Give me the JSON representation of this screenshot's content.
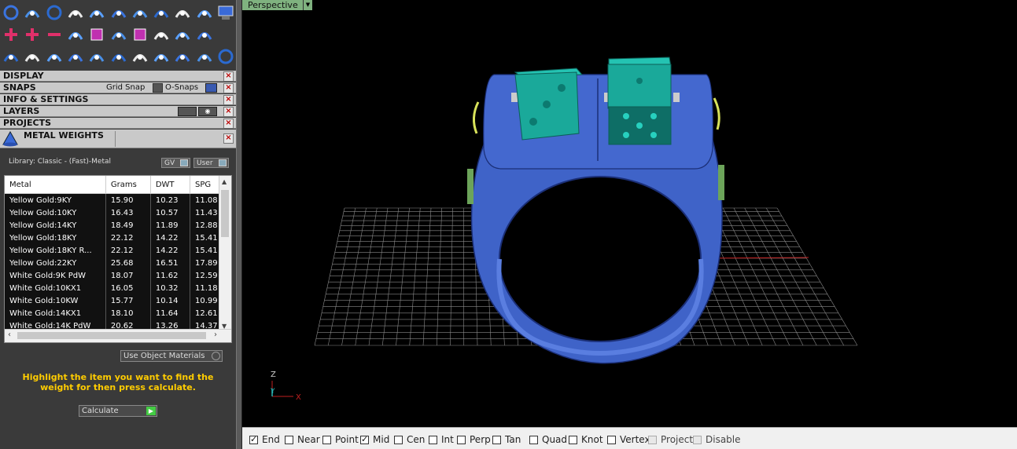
{
  "toolbar": {
    "rows": [
      [
        "circle-icon",
        "curve-icon",
        "ring-icon",
        "sweep-icon",
        "tools-icon",
        "cone-icon",
        "lasso-icon",
        "shield-icon",
        "gem-icon",
        "s-icon",
        "panel-icon"
      ],
      [
        "plus-icon",
        "plus-stack-icon",
        "minus-icon",
        "boolean-icon",
        "box-icon",
        "link-icon",
        "cube-icon",
        "check-icon",
        "grid-icon",
        "sphere-icon"
      ],
      [
        "cubes-icon",
        "arc-icon",
        "fillet-icon",
        "split-icon",
        "move-icon",
        "scale-icon",
        "explode-icon",
        "group-icon",
        "ungroup-icon",
        "cut-icon",
        "ring-outline-icon"
      ]
    ]
  },
  "panels": {
    "display": "DISPLAY",
    "snaps": "SNAPS",
    "grid_snap": "Grid Snap",
    "osnaps": "O-Snaps",
    "info": "INFO & SETTINGS",
    "layers": "LAYERS",
    "projects": "PROJECTS",
    "metal_weights": "METAL WEIGHTS"
  },
  "metal": {
    "library": "Library: Classic - (Fast)-Metal",
    "gv": "GV",
    "user": "User",
    "columns": [
      "Metal",
      "Grams",
      "DWT",
      "SPG"
    ],
    "rows": [
      [
        "Yellow Gold:9KY",
        "15.90",
        "10.23",
        "11.08"
      ],
      [
        "Yellow Gold:10KY",
        "16.43",
        "10.57",
        "11.43"
      ],
      [
        "Yellow Gold:14KY",
        "18.49",
        "11.89",
        "12.88"
      ],
      [
        "Yellow Gold:18KY",
        "22.12",
        "14.22",
        "15.41"
      ],
      [
        "Yellow Gold:18KY R...",
        "22.12",
        "14.22",
        "15.41"
      ],
      [
        "Yellow Gold:22KY",
        "25.68",
        "16.51",
        "17.89"
      ],
      [
        "White Gold:9K PdW",
        "18.07",
        "11.62",
        "12.59"
      ],
      [
        "White Gold:10KX1",
        "16.05",
        "10.32",
        "11.18"
      ],
      [
        "White Gold:10KW",
        "15.77",
        "10.14",
        "10.99"
      ],
      [
        "White Gold:14KX1",
        "18.10",
        "11.64",
        "12.61"
      ],
      [
        "White Gold:14K PdW",
        "20.62",
        "13.26",
        "14.37"
      ]
    ],
    "use_object_materials": "Use Object Materials",
    "hint": "Highlight the item you want to find the weight for then press calculate.",
    "calculate": "Calculate"
  },
  "viewport": {
    "label": "Perspective",
    "axis_z": "Z",
    "axis_y": "Y",
    "axis_x": "X"
  },
  "osnaps": [
    {
      "label": "End",
      "checked": true,
      "enabled": true
    },
    {
      "label": "Near",
      "checked": false,
      "enabled": true
    },
    {
      "label": "Point",
      "checked": false,
      "enabled": true
    },
    {
      "label": "Mid",
      "checked": true,
      "enabled": true
    },
    {
      "label": "Cen",
      "checked": false,
      "enabled": true
    },
    {
      "label": "Int",
      "checked": false,
      "enabled": true
    },
    {
      "label": "Perp",
      "checked": false,
      "enabled": true
    },
    {
      "label": "Tan",
      "checked": false,
      "enabled": true
    },
    {
      "label": "Quad",
      "checked": false,
      "enabled": true
    },
    {
      "label": "Knot",
      "checked": false,
      "enabled": true
    },
    {
      "label": "Vertex",
      "checked": false,
      "enabled": true
    },
    {
      "label": "Project",
      "checked": false,
      "enabled": false
    },
    {
      "label": "Disable",
      "checked": false,
      "enabled": false
    }
  ],
  "colors": {
    "ring": "#3f63c8",
    "dice": "#1aa99a",
    "hint": "#ffcc00",
    "grid": "#8a8a8a"
  }
}
